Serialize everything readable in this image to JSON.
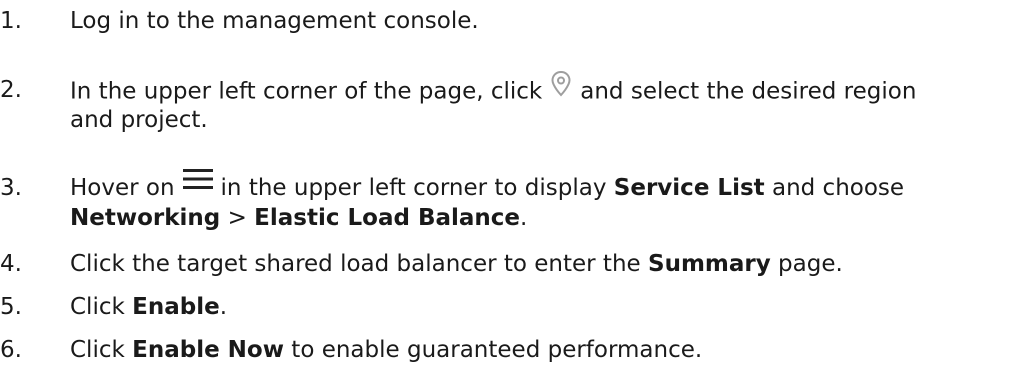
{
  "steps": [
    {
      "number": "1.",
      "text": "Log in to the management console."
    },
    {
      "number": "2.",
      "before_icon": "In the upper left corner of the page, click",
      "icon": "location-pin-icon",
      "after_icon_line1": "and select the desired region",
      "after_icon_line2": "and project."
    },
    {
      "number": "3.",
      "before_icon": "Hover on",
      "icon": "hamburger-menu-icon",
      "middle": "in the upper left corner to display",
      "bold_service_list": "Service List",
      "and_choose": "and choose",
      "bold_networking": "Networking",
      "separator": ">",
      "bold_elb": "Elastic Load Balance",
      "period": "."
    },
    {
      "number": "4.",
      "prefix": "Click the target shared load balancer to enter the",
      "bold": "Summary",
      "suffix": "page."
    },
    {
      "number": "5.",
      "prefix": "Click",
      "bold": "Enable",
      "suffix": "."
    },
    {
      "number": "6.",
      "prefix": "Click",
      "bold": "Enable Now",
      "suffix": "to enable guaranteed performance."
    }
  ],
  "colors": {
    "text": "#1a1a1a",
    "pin_icon": "#9e9e9e",
    "menu_icon": "#222222"
  }
}
